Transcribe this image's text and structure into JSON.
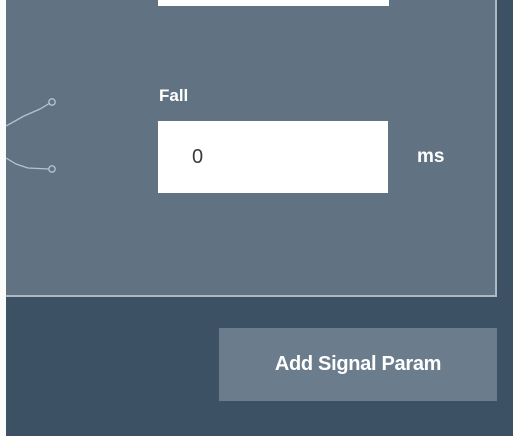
{
  "envelope_panel": {
    "fall": {
      "label": "Fall",
      "value": "0",
      "unit": "ms"
    }
  },
  "actions": {
    "add_signal_param_label": "Add Signal Param"
  },
  "colors": {
    "page_background": "#3d5165",
    "panel_background": "#617382",
    "panel_border": "#aeb8c1",
    "button_background": "#6b7d8c",
    "graph_line": "#b7c2cb"
  }
}
